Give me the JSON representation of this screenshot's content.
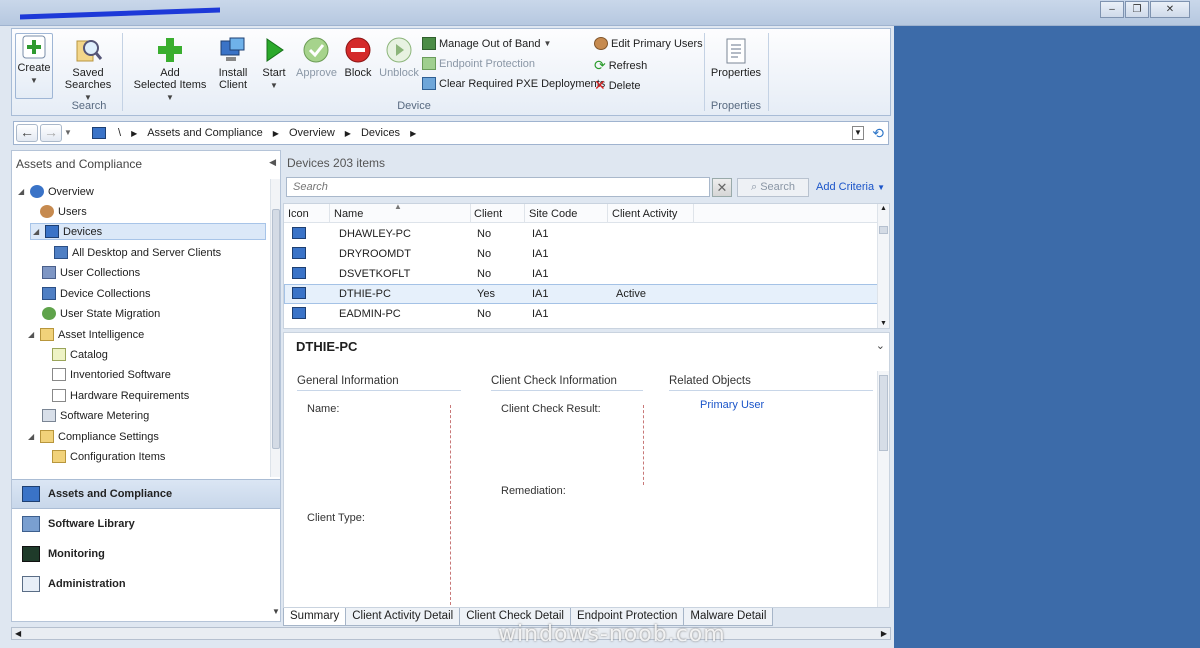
{
  "window": {
    "controls": [
      "–",
      "❐",
      "✕"
    ]
  },
  "ribbon": {
    "create": "Create",
    "saved_searches": "Saved\nSearches",
    "search_group": "Search",
    "add_selected": "Add\nSelected Items",
    "install_client": "Install\nClient",
    "start": "Start",
    "approve": "Approve",
    "block": "Block",
    "unblock": "Unblock",
    "manage_oob": "Manage Out of Band",
    "endpoint_protection": "Endpoint Protection",
    "clear_pxe": "Clear Required PXE Deployments",
    "edit_primary": "Edit Primary Users",
    "refresh": "Refresh",
    "delete": "Delete",
    "device_group": "Device",
    "properties": "Properties",
    "properties_group": "Properties"
  },
  "address": {
    "root": "\\",
    "crumbs": [
      "Assets and Compliance",
      "Overview",
      "Devices"
    ]
  },
  "nav": {
    "header": "Assets and Compliance",
    "tree": [
      {
        "label": "Overview"
      },
      {
        "label": "Users"
      },
      {
        "label": "Devices"
      },
      {
        "label": "All Desktop and Server Clients"
      },
      {
        "label": "User Collections"
      },
      {
        "label": "Device Collections"
      },
      {
        "label": "User State Migration"
      },
      {
        "label": "Asset Intelligence"
      },
      {
        "label": "Catalog"
      },
      {
        "label": "Inventoried Software"
      },
      {
        "label": "Hardware Requirements"
      },
      {
        "label": "Software Metering"
      },
      {
        "label": "Compliance Settings"
      },
      {
        "label": "Configuration Items"
      }
    ],
    "workspaces": [
      {
        "label": "Assets and Compliance"
      },
      {
        "label": "Software Library"
      },
      {
        "label": "Monitoring"
      },
      {
        "label": "Administration"
      }
    ]
  },
  "devices": {
    "header": "Devices 203 items",
    "search_placeholder": "Search",
    "search_button": "Search",
    "add_criteria": "Add Criteria",
    "columns": [
      "Icon",
      "Name",
      "Client",
      "Site Code",
      "Client Activity"
    ],
    "rows": [
      {
        "name": "DHAWLEY-PC",
        "client": "No",
        "site": "IA1",
        "activity": ""
      },
      {
        "name": "DRYROOMDT",
        "client": "No",
        "site": "IA1",
        "activity": ""
      },
      {
        "name": "DSVETKOFLT",
        "client": "No",
        "site": "IA1",
        "activity": ""
      },
      {
        "name": "DTHIE-PC",
        "client": "Yes",
        "site": "IA1",
        "activity": "Active"
      },
      {
        "name": "EADMIN-PC",
        "client": "No",
        "site": "IA1",
        "activity": ""
      }
    ]
  },
  "details": {
    "title": "DTHIE-PC",
    "general": "General Information",
    "client_check": "Client Check Information",
    "related": "Related Objects",
    "name_label": "Name:",
    "client_type_label": "Client Type:",
    "check_result_label": "Client Check Result:",
    "remediation_label": "Remediation:",
    "primary_user": "Primary User"
  },
  "tabs": [
    "Summary",
    "Client Activity Detail",
    "Client Check Detail",
    "Endpoint Protection",
    "Malware Detail"
  ],
  "watermark": "windows-noob.com"
}
